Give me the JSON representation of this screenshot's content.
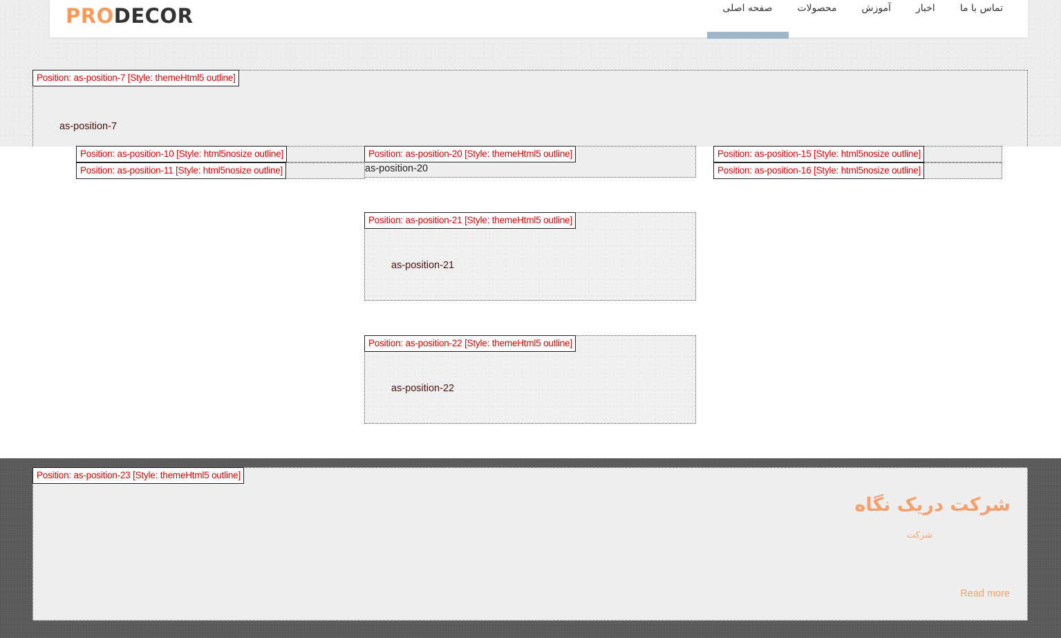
{
  "header": {
    "logo_pro": "PRO",
    "logo_decor": "DECOR",
    "nav": [
      {
        "label": "صفحه اصلی",
        "active": true
      },
      {
        "label": "محصولات"
      },
      {
        "label": "آموزش"
      },
      {
        "label": "اخبار"
      },
      {
        "label": "تماس با ما"
      }
    ]
  },
  "positions": {
    "p7": {
      "label": "Position: as-position-7 [Style: themeHtml5 outline]",
      "content": "as-position-7"
    },
    "p10": {
      "label": "Position: as-position-10 [Style: html5nosize outline]"
    },
    "p11": {
      "label": "Position: as-position-11 [Style: html5nosize outline]"
    },
    "p20": {
      "label": "Position: as-position-20 [Style: themeHtml5 outline]",
      "content": "as-position-20"
    },
    "p15": {
      "label": "Position: as-position-15 [Style: html5nosize outline]"
    },
    "p16": {
      "label": "Position: as-position-16 [Style: html5nosize outline]"
    },
    "p21": {
      "label": "Position: as-position-21 [Style: themeHtml5 outline]",
      "content": "as-position-21"
    },
    "p22": {
      "label": "Position: as-position-22 [Style: themeHtml5 outline]",
      "content": "as-position-22"
    },
    "p23": {
      "label": "Position: as-position-23 [Style: themeHtml5 outline]"
    }
  },
  "footer": {
    "title": "شرکت دریک نگاه",
    "subtitle": "شرکت",
    "read_more": "Read more"
  },
  "colors": {
    "accent": "#f5a06c",
    "label_red": "#e00000",
    "nav_active_bar": "#9eb6c8"
  }
}
